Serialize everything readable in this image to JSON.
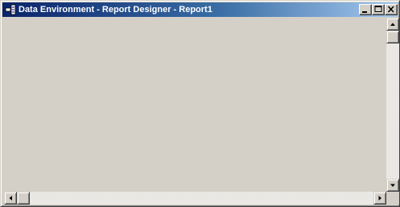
{
  "window": {
    "title": "Data Environment - Report Designer - Report1",
    "icon": "report-designer-icon"
  },
  "title_buttons": {
    "minimize": "minimize-icon",
    "maximize": "maximize-icon",
    "close": "close-icon"
  },
  "scrollbars": {
    "vertical_position": 0,
    "horizontal_position": 0
  },
  "colors": {
    "face": "#d4d0c8",
    "title_active_start": "#0a246a",
    "title_active_end": "#a6caf0"
  }
}
